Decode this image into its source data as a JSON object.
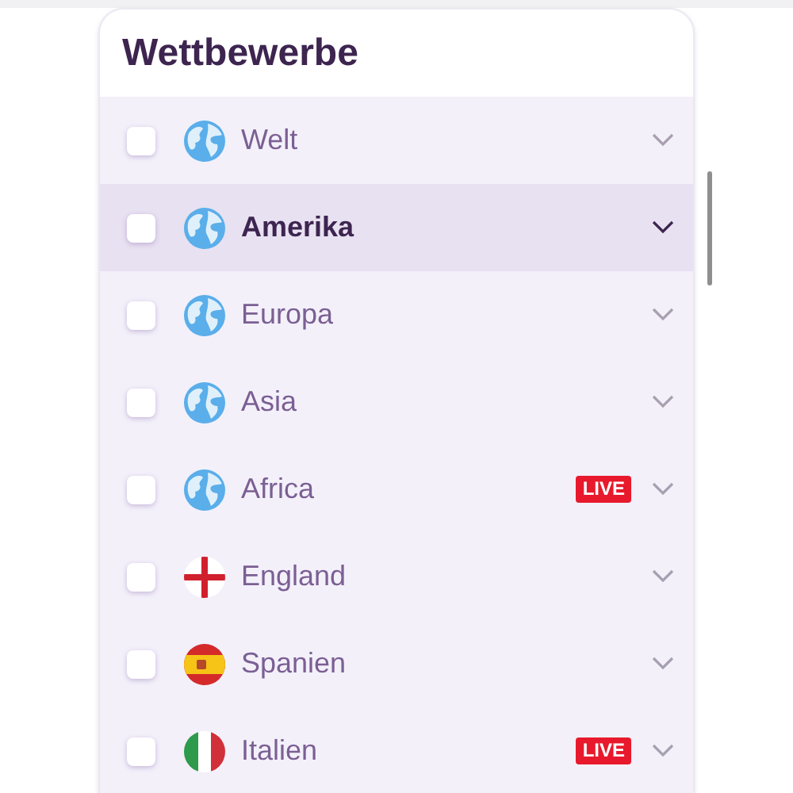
{
  "panel": {
    "title": "Wettbewerbe"
  },
  "items": [
    {
      "label": "Welt",
      "kind": "globe",
      "selected": false,
      "checked": false
    },
    {
      "label": "Amerika",
      "kind": "globe",
      "selected": true,
      "checked": false
    },
    {
      "label": "Europa",
      "kind": "globe",
      "selected": false,
      "checked": false
    },
    {
      "label": "Asia",
      "kind": "globe",
      "selected": false,
      "checked": false
    },
    {
      "label": "Africa",
      "kind": "globe",
      "selected": false,
      "checked": false,
      "badge": "LIVE"
    },
    {
      "label": "England",
      "kind": "england",
      "selected": false,
      "checked": false
    },
    {
      "label": "Spanien",
      "kind": "spain",
      "selected": false,
      "checked": false
    },
    {
      "label": "Italien",
      "kind": "italy",
      "selected": false,
      "checked": false,
      "badge": "LIVE"
    }
  ]
}
